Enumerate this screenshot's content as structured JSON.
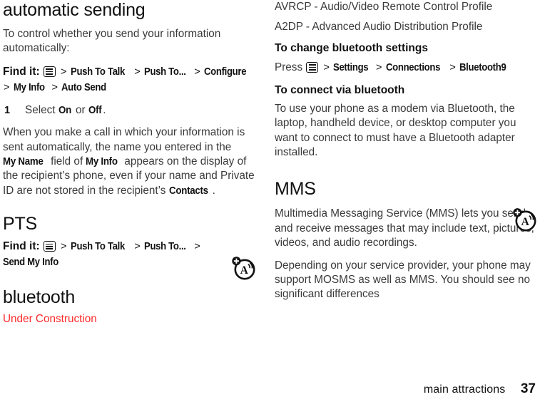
{
  "document": {
    "page_number": "37",
    "footer_label": "main attractions"
  },
  "colors": {
    "heading": "#111111",
    "body": "#3a3a3a",
    "warning_red": "#FF2A2A"
  },
  "icons": {
    "menu_key": "menu-key-icon",
    "audio_profile": "audio-profile-circle-icon"
  },
  "left_column": {
    "section_heading": "automatic sending",
    "intro_paragraph": "To control whether you send your information automatically:",
    "find_it": {
      "lead": "Find it:",
      "path": [
        "Push To Talk",
        "Push To...",
        "Configure",
        "My Info",
        "Auto Send"
      ],
      "separator": ">"
    },
    "step": {
      "number": "1",
      "text_before": "Select ",
      "option_on": "On",
      "text_middle": " or ",
      "option_off": "Off",
      "text_after": "."
    },
    "explanation": {
      "part1": "When you make a call in which your information is sent automatically, the name you entered in the ",
      "term1": "My Name",
      "part2": " field of ",
      "term2": "My Info",
      "part3": " appears on the display of the recipient’s phone, even if your name and Private ID are not stored in the recipient’s ",
      "term3": "Contacts",
      "part4": "."
    },
    "pts": {
      "heading": "PTS",
      "find_it_lead": "Find it:",
      "path": [
        "Push To Talk",
        "Push To...",
        "Send My Info"
      ],
      "separator": ">"
    },
    "bluetooth": {
      "heading": "bluetooth",
      "note": "Under Construction"
    }
  },
  "right_column": {
    "profiles": [
      "AVRCP - Audio/Video Remote Control Profile",
      "A2DP - Advanced Audio Distribution Profile"
    ],
    "change_settings": {
      "heading": "To change bluetooth settings",
      "lead": "Press",
      "path": [
        "Settings",
        "Connections",
        "Bluetooth9"
      ],
      "separator": ">"
    },
    "connect": {
      "heading": "To connect via bluetooth",
      "paragraph": "To use your phone as a modem via Bluetooth, the laptop, handheld device, or desktop computer you want to connect to must have a Bluetooth adapter installed."
    },
    "mms": {
      "heading": "MMS",
      "paragraph1": "Multimedia Messaging Service (MMS) lets you send and receive messages that may include text, pictures, videos, and audio recordings.",
      "paragraph2": "Depending on your service provider, your phone may support MOSMS as well as MMS. You should see no significant differences"
    }
  }
}
